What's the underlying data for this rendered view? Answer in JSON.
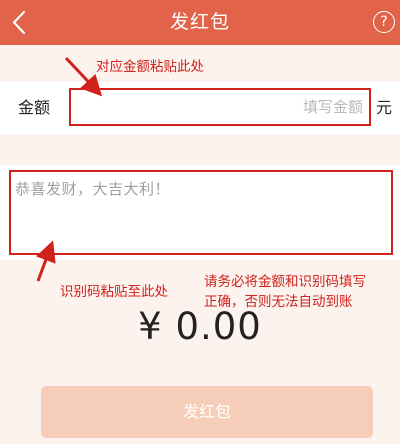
{
  "header": {
    "title": "发红包",
    "back_icon": "chevron-left-icon",
    "help_label": "?",
    "background_color": "#e0634a"
  },
  "annotations": {
    "amount_hint": "对应金额粘贴此处",
    "code_hint": "识别码粘贴至此处",
    "warning_line1": "请务必将金额和识别码填写",
    "warning_line2": "正确，否则无法自动到账",
    "color": "#d0211c"
  },
  "amount": {
    "label": "金额",
    "placeholder": "填写金额",
    "unit": "元",
    "value": ""
  },
  "message": {
    "placeholder": "恭喜发财，大吉大利！",
    "value": ""
  },
  "total": {
    "display": "¥ 0.00"
  },
  "send_button": {
    "label": "发红包",
    "color": "#f6cdb8"
  }
}
